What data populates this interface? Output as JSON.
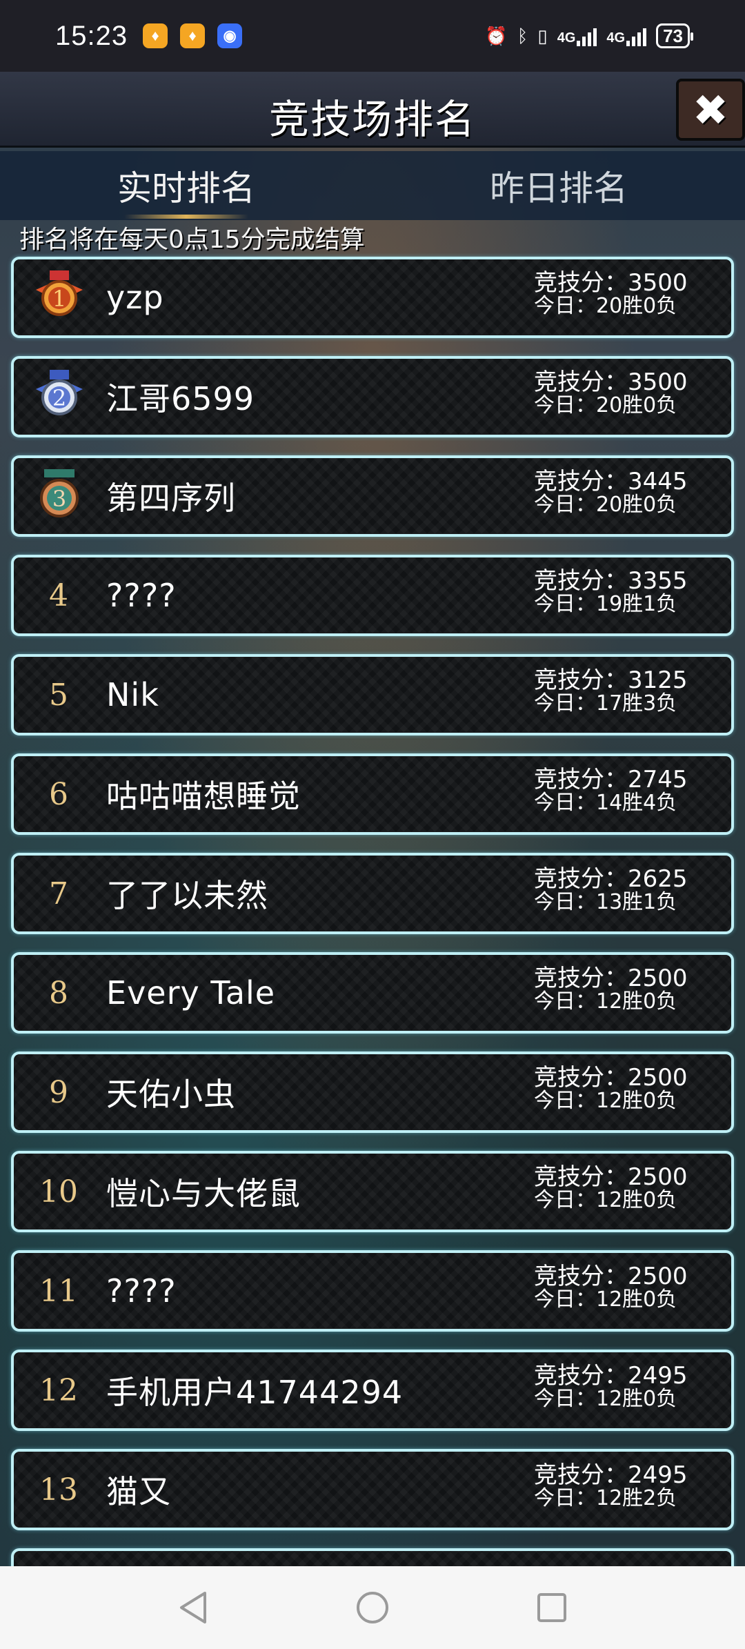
{
  "status_bar": {
    "time": "15:23",
    "network1": "4G",
    "network2": "4G",
    "battery": "73"
  },
  "header": {
    "title": "竞技场排名",
    "close_label": "✖"
  },
  "tabs": [
    {
      "label": "实时排名",
      "active": true
    },
    {
      "label": "昨日排名",
      "active": false
    }
  ],
  "notice": "排名将在每天0点15分完成结算",
  "score_label": "竞技分：",
  "today_label": "今日：",
  "rankings": [
    {
      "rank": "1",
      "name": "yzp",
      "score": "3500",
      "today": "20胜0负"
    },
    {
      "rank": "2",
      "name": "江哥6599",
      "score": "3500",
      "today": "20胜0负"
    },
    {
      "rank": "3",
      "name": "第四序列",
      "score": "3445",
      "today": "20胜0负"
    },
    {
      "rank": "4",
      "name": "????",
      "score": "3355",
      "today": "19胜1负"
    },
    {
      "rank": "5",
      "name": "Nik",
      "score": "3125",
      "today": "17胜3负"
    },
    {
      "rank": "6",
      "name": "咕咕喵想睡觉",
      "score": "2745",
      "today": "14胜4负"
    },
    {
      "rank": "7",
      "name": "了了以未然",
      "score": "2625",
      "today": "13胜1负"
    },
    {
      "rank": "8",
      "name": "Every Tale",
      "score": "2500",
      "today": "12胜0负"
    },
    {
      "rank": "9",
      "name": "天佑小虫",
      "score": "2500",
      "today": "12胜0负"
    },
    {
      "rank": "10",
      "name": "愷心与大佬鼠",
      "score": "2500",
      "today": "12胜0负"
    },
    {
      "rank": "11",
      "name": "????",
      "score": "2500",
      "today": "12胜0负"
    },
    {
      "rank": "12",
      "name": "手机用户41744294",
      "score": "2495",
      "today": "12胜0负"
    },
    {
      "rank": "13",
      "name": "猫又",
      "score": "2495",
      "today": "12胜2负"
    }
  ],
  "colors": {
    "row_border": "#bfeff5",
    "rank_number": "#e8c98a",
    "medal_gold": "#e6562a",
    "medal_silver": "#4b6fd6",
    "medal_bronze": "#3b8a7a"
  }
}
